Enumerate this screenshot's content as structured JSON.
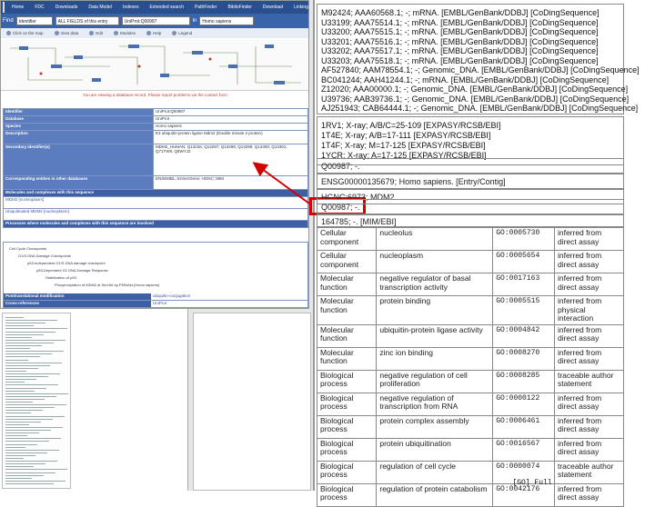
{
  "left_window": {
    "nav_items": [
      "Home",
      "FDC",
      "Downloads",
      "Data Model",
      "Indexes",
      "Extended search",
      "PathFinder",
      "BiblioFinder",
      "Download",
      "Linking",
      "Citing"
    ],
    "search": {
      "find_label": "Find",
      "find_value": "Identifier",
      "in_label": "in",
      "scope_value": "ALL FIELDS of this entry",
      "query_value": "UniProt:Q00987",
      "in_label2": "in",
      "species_value": "Homo sapiens"
    },
    "icon_row": [
      "Click on the map",
      "View data",
      "Edit",
      "Modules",
      "Help",
      "Legend"
    ],
    "notice": "You are viewing a database record. Please report problems via the contact form.",
    "table_rows": [
      {
        "key": "Identifier",
        "value": "UniProt:Q00987"
      },
      {
        "key": "Database",
        "value": "UniProt"
      },
      {
        "key": "Species",
        "value": "Homo sapiens"
      },
      {
        "key": "Description",
        "value": "E3 ubiquitin-protein ligase Mdm2 (Double minute 2 protein)"
      },
      {
        "key": "Secondary identifier(s)",
        "value": "MDM2_HUMAN; Q13226; Q13297; Q13298; Q13299; Q13300; Q13301; Q71TW9; Q8WYJ2"
      },
      {
        "key": "Corresponding entities in other databases",
        "value": "ENSEMBL; EntrezGene; HGNC; MIM"
      }
    ],
    "section_row": "Molecules and complexes with this sequence",
    "plain_rows": [
      "MDM2 [nucleoplasm]",
      "Ubiquitinated MDM2 [nucleoplasm]"
    ],
    "section_row2": "Processes where molecules and complexes with this sequence are involved",
    "tree_lines": [
      "Cell Cycle Checkpoints",
      "G1/S DNA Damage Checkpoints",
      "p53-Independent G1/S DNA damage checkpoint",
      "p53-Dependent G1 DNA Damage Response",
      "Stabilization of p53",
      "Phosphorylation of MDM2 at Ser166 by PKB/Akt (Homo sapiens)"
    ],
    "bottom_rows": [
      {
        "key": "Posttranslational modification",
        "value": "ubiquitin-conjugation"
      },
      {
        "key": "Cross-references",
        "value": "UniProt"
      }
    ]
  },
  "right_window": {
    "xref_lines": [
      "M92424; AAA60568.1; -; mRNA.      [EMBL/GenBank/DDBJ] [CoDingSequence]",
      "U33199; AAA75514.1; -; mRNA.      [EMBL/GenBank/DDBJ] [CoDingSequence]",
      "U33200; AAA75515.1; -; mRNA.      [EMBL/GenBank/DDBJ] [CoDingSequence]",
      "U33201; AAA75516.1; -; mRNA.      [EMBL/GenBank/DDBJ] [CoDingSequence]",
      "U33202; AAA75517.1; -; mRNA.      [EMBL/GenBank/DDBJ] [CoDingSequence]",
      "U33203; AAA75518.1; -; mRNA.      [EMBL/GenBank/DDBJ] [CoDingSequence]",
      "AF527840; AAM78554.1; -; Genomic_DNA. [EMBL/GenBank/DDBJ] [CoDingSequence]",
      "BC041244; AAH41244.1; -; mRNA.    [EMBL/GenBank/DDBJ] [CoDingSequence]",
      "Z12020; AAA00000.1; -; Genomic_DNA. [EMBL/GenBank/DDBJ] [CoDingSequence]",
      "U39736; AAB39736.1; -; Genomic_DNA. [EMBL/GenBank/DDBJ] [CoDingSequence]",
      "AJ251943; CAB64444.1; -; Genomic_DNA. [EMBL/GenBank/DDBJ] [CoDingSequence]"
    ],
    "pdb_lines": [
      "1RV1; X-ray; A/B/C=25-109  [EXPASY/RCSB/EBI]",
      "1T4E; X-ray; A/B=17-111    [EXPASY/RCSB/EBI]",
      "1T4F; X-ray; M=17-125      [EXPASY/RCSB/EBI]",
      "1YCR; X-ray; A=17-125      [EXPASY/RCSB/EBI]"
    ],
    "record_rows": [
      "Q00987; -.",
      "ENSG00000135679; Homo sapiens. [Entry/Contig]",
      "HGNC:6973; MDM2.",
      "Q00987; -.",
      "164785; -. [MIM/EBI]"
    ],
    "go_rows": [
      {
        "category": "Cellular component",
        "term": "nucleolus",
        "id": "GO:0005730",
        "evidence": "inferred from direct assay"
      },
      {
        "category": "Cellular component",
        "term": "nucleoplasm",
        "id": "GO:0005654",
        "evidence": "inferred from direct assay"
      },
      {
        "category": "Molecular function",
        "term": "negative regulator of basal transcription activity",
        "id": "GO:0017163",
        "evidence": "inferred from direct assay"
      },
      {
        "category": "Molecular function",
        "term": "protein binding",
        "id": "GO:0005515",
        "evidence": "inferred from physical interaction"
      },
      {
        "category": "Molecular function",
        "term": "ubiquitin-protein ligase activity",
        "id": "GO:0004842",
        "evidence": "inferred from direct assay"
      },
      {
        "category": "Molecular function",
        "term": "zinc ion binding",
        "id": "GO:0008270",
        "evidence": "inferred from direct assay"
      },
      {
        "category": "Biological process",
        "term": "negative regulation of cell proliferation",
        "id": "GO:0008285",
        "evidence": "traceable author statement"
      },
      {
        "category": "Biological process",
        "term": "negative regulation of transcription from RNA",
        "id": "GO:0000122",
        "evidence": "inferred from direct assay"
      },
      {
        "category": "Biological process",
        "term": "protein complex assembly",
        "id": "GO:0006461",
        "evidence": "inferred from direct assay"
      },
      {
        "category": "Biological process",
        "term": "protein ubiquitination",
        "id": "GO:0016567",
        "evidence": "inferred from direct assay"
      },
      {
        "category": "Biological process",
        "term": "regulation of cell cycle",
        "id": "GO:0000074",
        "evidence": "traceable author statement"
      },
      {
        "category": "Biological process",
        "term": "regulation of protein catabolism",
        "id": "GO:0042176",
        "evidence": "inferred from direct assay"
      }
    ],
    "more_label": "[GO] Full"
  },
  "colors": {
    "nav_bg": "#2a4f8f",
    "table_key_bg": "#5b7cbe",
    "highlight": "#d40000",
    "arrow": "#d40000"
  }
}
